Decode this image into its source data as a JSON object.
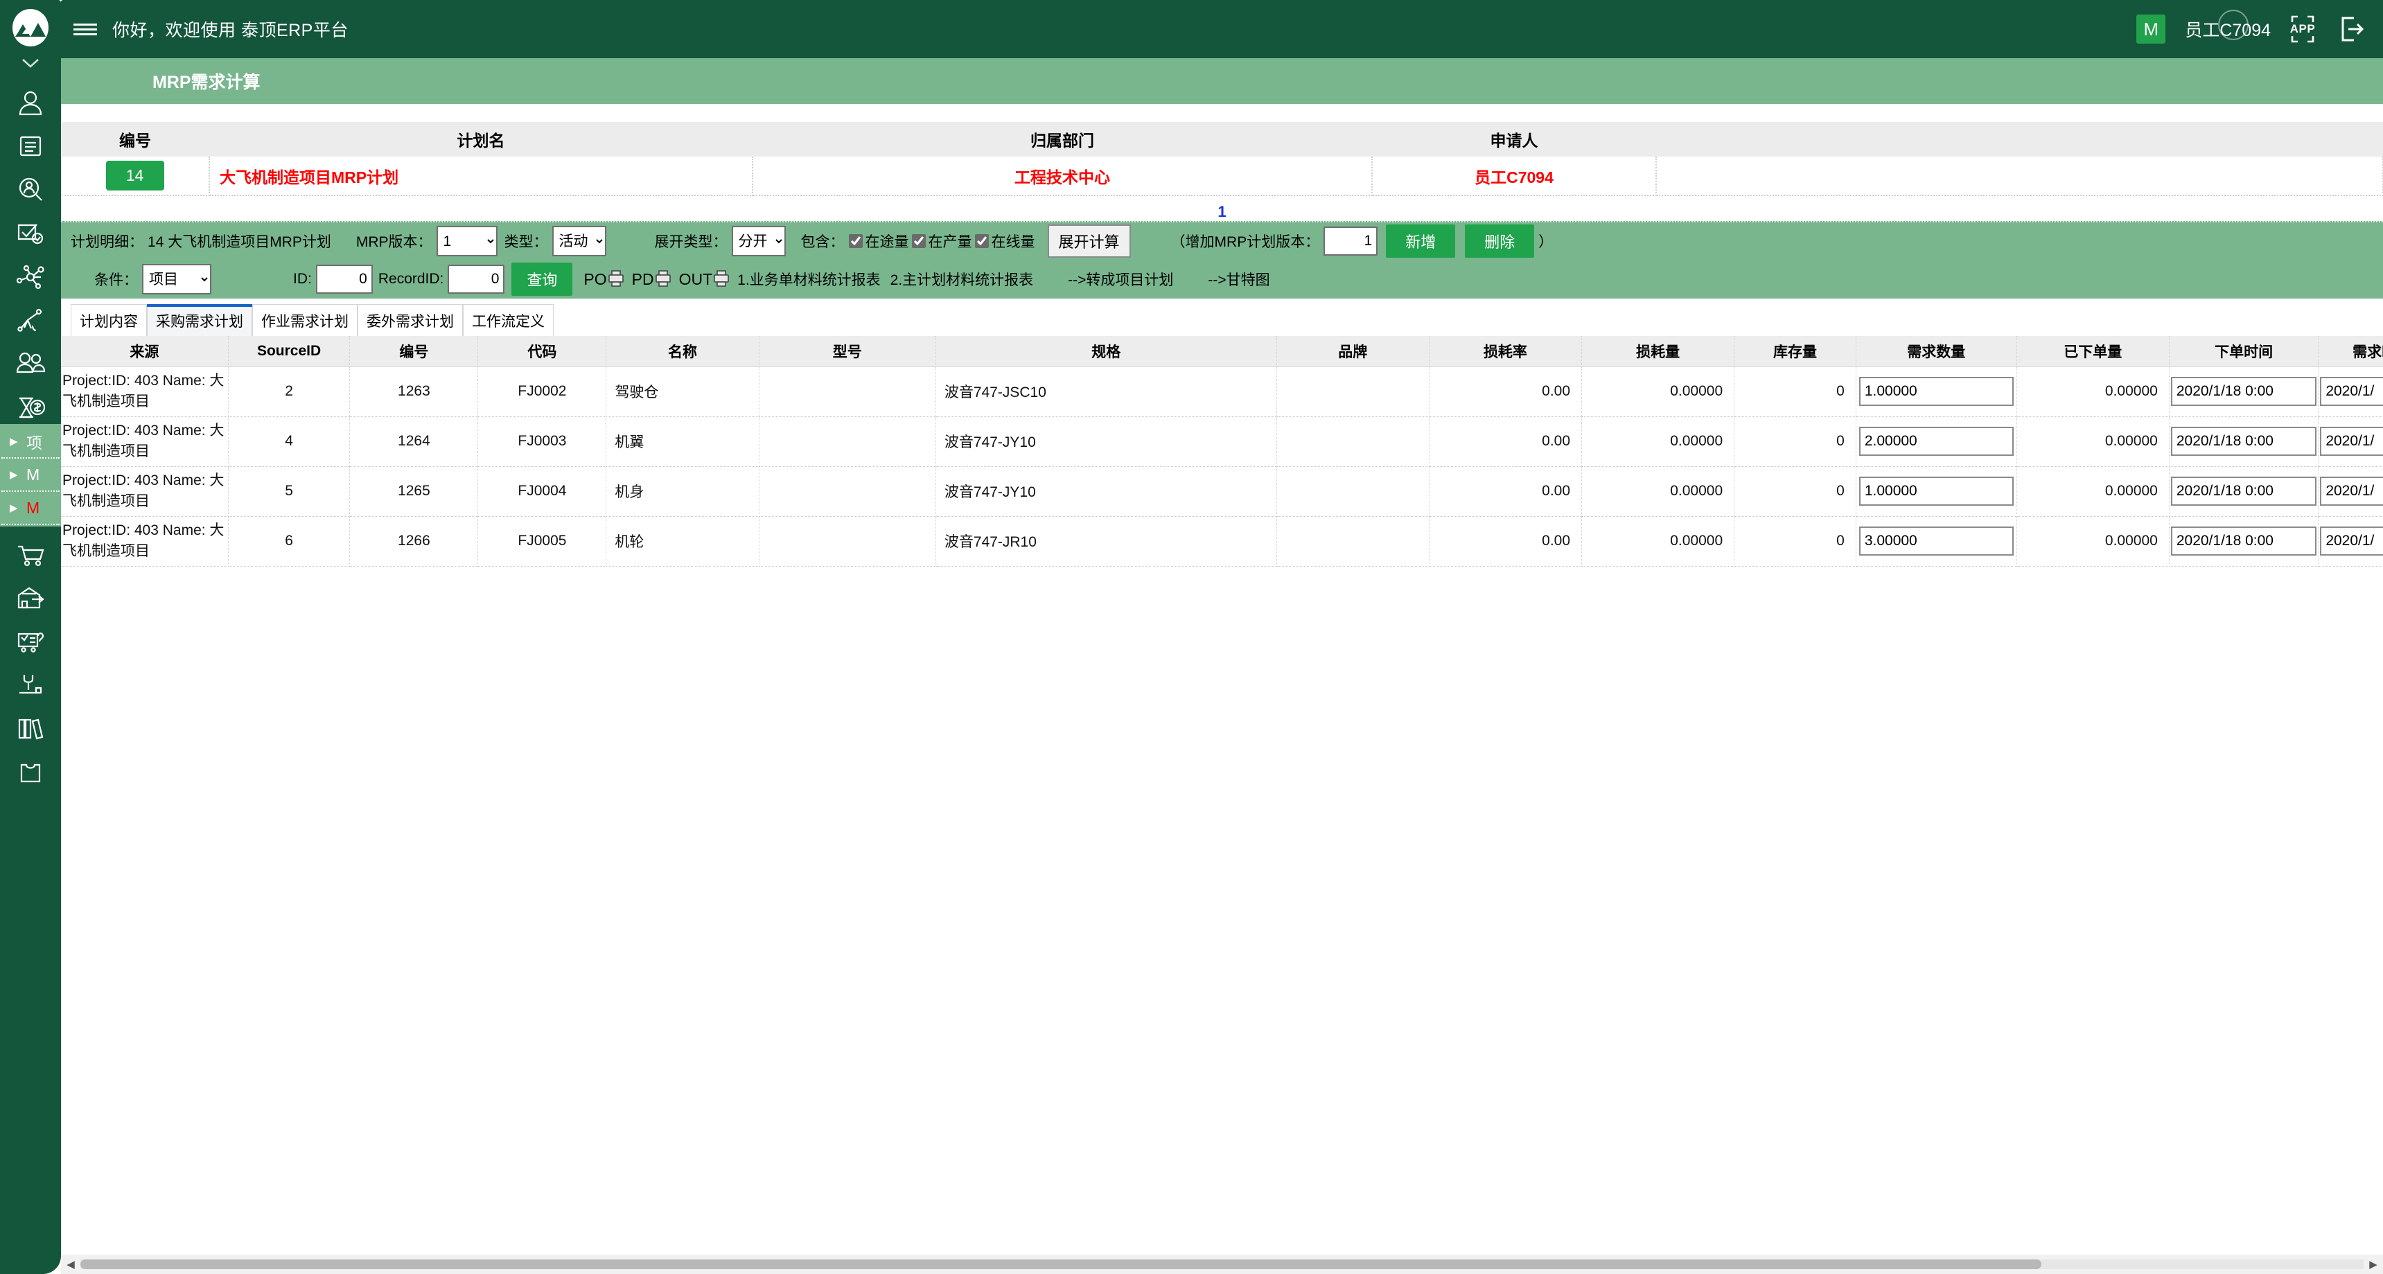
{
  "brand": {
    "logo_icon": "mountain-logo-icon",
    "accent_dark": "#14563c",
    "accent_mid": "#79b68e",
    "accent_green": "#1fa34c",
    "link_red": "#ff0000",
    "pager_blue": "#1a34d8"
  },
  "topbar": {
    "greeting": "你好，欢迎使用 泰顶ERP平台",
    "mail_badge": "M",
    "username": "员工C7094",
    "app_label": "APP",
    "logout_icon": "logout-icon",
    "hamburger_icon": "hamburger-icon"
  },
  "sidebar": {
    "items": [
      {
        "name": "chevron-down-icon",
        "label": ""
      },
      {
        "name": "person-icon",
        "label": ""
      },
      {
        "name": "document-lines-icon",
        "label": ""
      },
      {
        "name": "person-search-icon",
        "label": ""
      },
      {
        "name": "checklist-approve-icon",
        "label": ""
      },
      {
        "name": "network-nodes-icon",
        "label": ""
      },
      {
        "name": "tree-branch-icon",
        "label": ""
      },
      {
        "name": "people-group-icon",
        "label": ""
      },
      {
        "name": "hourglass-money-icon",
        "label": ""
      }
    ],
    "submenu": [
      {
        "label": "项",
        "color": "#ffffff"
      },
      {
        "label": "M",
        "color": "#ffffff"
      },
      {
        "label": "M",
        "color": "#ff0000"
      }
    ],
    "items_bottom": [
      {
        "name": "shopping-cart-icon",
        "label": ""
      },
      {
        "name": "warehouse-out-icon",
        "label": ""
      },
      {
        "name": "cart-checklist-icon",
        "label": ""
      },
      {
        "name": "machine-tool-icon",
        "label": ""
      },
      {
        "name": "books-icon",
        "label": ""
      },
      {
        "name": "tshirt-icon",
        "label": ""
      }
    ]
  },
  "page": {
    "title": "MRP需求计算",
    "header_table": {
      "columns": [
        "编号",
        "计划名",
        "归属部门",
        "申请人"
      ],
      "rows": [
        {
          "code": "14",
          "plan_name": "大飞机制造项目MRP计划",
          "department": "工程技术中心",
          "applicant": "员工C7094"
        }
      ]
    },
    "pager": "1"
  },
  "filters": {
    "plan_detail_label": "计划明细：",
    "plan_detail_value": "14 大飞机制造项目MRP计划",
    "mrp_version_label": "MRP版本：",
    "mrp_version_value": "1",
    "mrp_version_options": [
      "1"
    ],
    "type_label": "类型：",
    "type_value": "活动",
    "type_options": [
      "活动"
    ],
    "expand_type_label": "展开类型：",
    "expand_type_value": "分开",
    "expand_type_options": [
      "分开"
    ],
    "include_label": "包含：",
    "checkboxes": [
      {
        "label": "在途量",
        "checked": true
      },
      {
        "label": "在产量",
        "checked": true
      },
      {
        "label": "在线量",
        "checked": true
      }
    ],
    "expand_calc_button": "展开计算",
    "add_version_prefix": "（增加MRP计划版本：",
    "add_version_value": "1",
    "add_button": "新增",
    "delete_button": "删除",
    "add_version_suffix": "）",
    "condition_label": "条件：",
    "condition_value": "项目",
    "condition_options": [
      "项目"
    ],
    "id_label": "ID:",
    "id_value": "0",
    "recordid_label": "RecordID:",
    "recordid_value": "0",
    "query_button": "查询",
    "print_buttons": [
      {
        "label": "PO",
        "icon": "printer-icon"
      },
      {
        "label": "PD",
        "icon": "printer-icon"
      },
      {
        "label": "OUT",
        "icon": "printer-icon"
      }
    ],
    "links": [
      "1.业务单材料统计报表",
      "2.主计划材料统计报表",
      "-->转成项目计划",
      "-->甘特图"
    ]
  },
  "tabs": [
    {
      "label": "计划内容",
      "active": false
    },
    {
      "label": "采购需求计划",
      "active": true
    },
    {
      "label": "作业需求计划",
      "active": false
    },
    {
      "label": "委外需求计划",
      "active": false
    },
    {
      "label": "工作流定义",
      "active": false
    }
  ],
  "grid": {
    "columns": [
      "来源",
      "SourceID",
      "编号",
      "代码",
      "名称",
      "型号",
      "规格",
      "品牌",
      "损耗率",
      "损耗量",
      "库存量",
      "需求数量",
      "已下单量",
      "下单时间",
      "需求时"
    ],
    "rows": [
      {
        "source": "Project:ID: 403 Name: 大飞机制造项目",
        "source_id": "2",
        "code_no": "1263",
        "code": "FJ0002",
        "name": "驾驶仓",
        "model": "",
        "spec": "波音747-JSC10",
        "brand": "",
        "loss_rate": "0.00",
        "loss_qty": "0.00000",
        "stock_qty": "0",
        "demand_qty": "1.00000",
        "ordered_qty": "0.00000",
        "order_time": "2020/1/18 0:00",
        "demand_time": "2020/1/"
      },
      {
        "source": "Project:ID: 403 Name: 大飞机制造项目",
        "source_id": "4",
        "code_no": "1264",
        "code": "FJ0003",
        "name": "机翼",
        "model": "",
        "spec": "波音747-JY10",
        "brand": "",
        "loss_rate": "0.00",
        "loss_qty": "0.00000",
        "stock_qty": "0",
        "demand_qty": "2.00000",
        "ordered_qty": "0.00000",
        "order_time": "2020/1/18 0:00",
        "demand_time": "2020/1/"
      },
      {
        "source": "Project:ID: 403 Name: 大飞机制造项目",
        "source_id": "5",
        "code_no": "1265",
        "code": "FJ0004",
        "name": "机身",
        "model": "",
        "spec": "波音747-JY10",
        "brand": "",
        "loss_rate": "0.00",
        "loss_qty": "0.00000",
        "stock_qty": "0",
        "demand_qty": "1.00000",
        "ordered_qty": "0.00000",
        "order_time": "2020/1/18 0:00",
        "demand_time": "2020/1/"
      },
      {
        "source": "Project:ID: 403 Name: 大飞机制造项目",
        "source_id": "6",
        "code_no": "1266",
        "code": "FJ0005",
        "name": "机轮",
        "model": "",
        "spec": "波音747-JR10",
        "brand": "",
        "loss_rate": "0.00",
        "loss_qty": "0.00000",
        "stock_qty": "0",
        "demand_qty": "3.00000",
        "ordered_qty": "0.00000",
        "order_time": "2020/1/18 0:00",
        "demand_time": "2020/1/"
      }
    ]
  },
  "hscroll": {
    "left_arrow": "◀",
    "right_arrow": "▶"
  }
}
